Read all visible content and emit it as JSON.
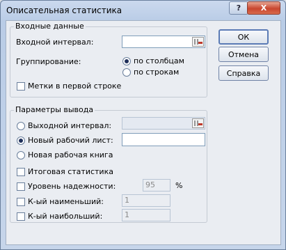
{
  "window": {
    "title": "Описательная статистика",
    "help_glyph": "?",
    "close_glyph": "X"
  },
  "input_group": {
    "title": "Входные данные",
    "input_range_label": "Входной интервал:",
    "input_range_value": "",
    "grouping_label": "Группирование:",
    "by_columns_label": "по столбцам",
    "by_rows_label": "по строкам",
    "grouping_selected": "по столбцам",
    "labels_first_row_label": "Метки в первой строке",
    "labels_first_row_checked": false
  },
  "output_group": {
    "title": "Параметры вывода",
    "output_range_label": "Выходной интервал:",
    "output_range_value": "",
    "new_sheet_label": "Новый рабочий лист:",
    "new_sheet_value": "",
    "new_workbook_label": "Новая рабочая книга",
    "output_selected": "Новый рабочий лист:",
    "summary_stats_label": "Итоговая статистика",
    "summary_stats_checked": false,
    "confidence_label": "Уровень надежности:",
    "confidence_value": "95",
    "confidence_unit": "%",
    "confidence_checked": false,
    "kth_smallest_label": "К-ый наименьший:",
    "kth_smallest_value": "1",
    "kth_smallest_checked": false,
    "kth_largest_label": "К-ый наибольший:",
    "kth_largest_value": "1",
    "kth_largest_checked": false
  },
  "buttons": {
    "ok": "ОК",
    "cancel": "Отмена",
    "help": "Справка"
  },
  "colors": {
    "title_bar": "#b9cce6",
    "close_button": "#c9462f",
    "client": "#eaedf2"
  }
}
